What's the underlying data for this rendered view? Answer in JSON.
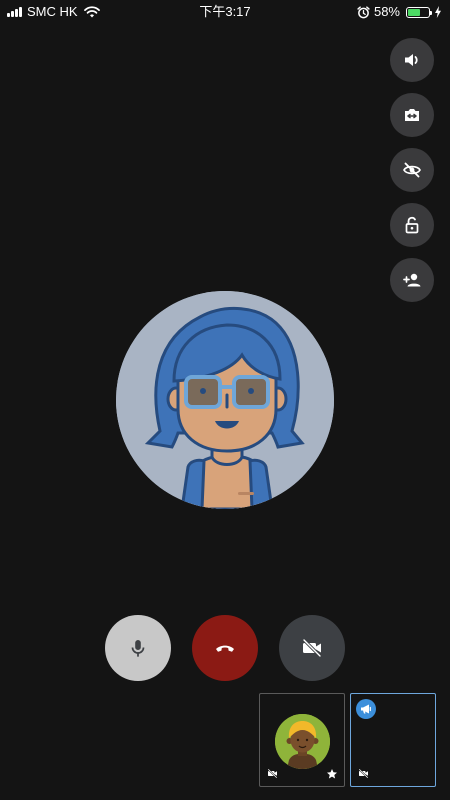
{
  "status_bar": {
    "carrier": "SMC HK",
    "time": "下午3:17",
    "battery_percent_label": "58%",
    "battery_level": 0.58,
    "icons": [
      "signal-icon",
      "wifi-icon",
      "alarm-icon",
      "battery-icon",
      "charging-bolt-icon"
    ]
  },
  "side_controls": [
    {
      "name": "speaker-button",
      "icon": "speaker-volume-icon"
    },
    {
      "name": "switch-camera-button",
      "icon": "switch-camera-icon"
    },
    {
      "name": "hide-view-button",
      "icon": "eye-off-icon"
    },
    {
      "name": "lock-button",
      "icon": "unlock-icon"
    },
    {
      "name": "add-participant-button",
      "icon": "add-person-icon"
    }
  ],
  "main_participant": {
    "avatar": "avatar-woman-blue-hair-glasses",
    "background_color": "#a9b4c4"
  },
  "call_controls": {
    "mic": {
      "icon": "microphone-icon",
      "color": "#c8c8c8"
    },
    "hangup": {
      "icon": "end-call-icon",
      "color": "#8b1a14"
    },
    "video": {
      "icon": "video-off-icon",
      "color": "#3d4044"
    }
  },
  "participants": [
    {
      "type": "local",
      "avatar": "avatar-man-yellow-hair",
      "camera": "off",
      "starred": true,
      "border_color": "#5a5a5a"
    },
    {
      "type": "remote",
      "dominant_speaker": true,
      "camera": "off",
      "border_color": "#6ea7dd"
    }
  ]
}
